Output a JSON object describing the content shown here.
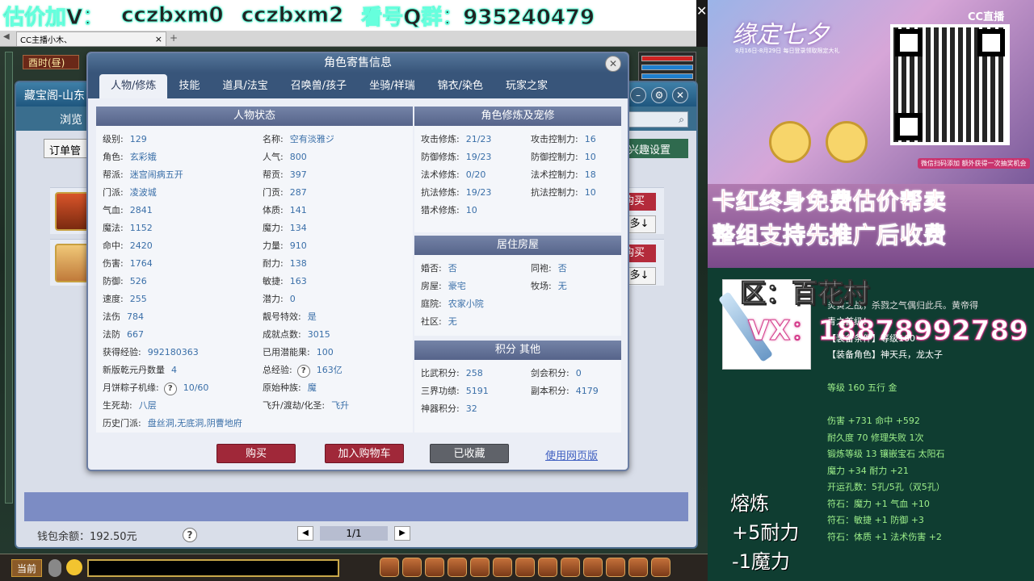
{
  "banner": {
    "part1": "估价加V：",
    "part2": "cczbxm0",
    "part3": "cczbxm2",
    "part4": "看号Q群：935240479"
  },
  "browser": {
    "tab_label": "CC主播小木、",
    "tab_close": "×",
    "tab_add": "+"
  },
  "game": {
    "clock": "酉时(昼)",
    "back_window": {
      "title": "藏宝阁-山东",
      "nav": "浏览",
      "order": "订单管",
      "interest": "兴趣设置",
      "buy": "购买",
      "more": "更多↓",
      "wallet": "钱包余额：192.50元",
      "page": "1/1"
    },
    "taskbar_current": "当前"
  },
  "dialog": {
    "title": "角色寄售信息",
    "close": "✕",
    "tabs": [
      "人物/修炼",
      "技能",
      "道具/法宝",
      "召唤兽/孩子",
      "坐骑/祥瑞",
      "锦衣/染色",
      "玩家之家"
    ],
    "status": {
      "header": "人物状态",
      "left": [
        {
          "k": "级别:",
          "v": "129"
        },
        {
          "k": "角色:",
          "v": "玄彩娥"
        },
        {
          "k": "帮派:",
          "v": "迷宫闹病五开"
        },
        {
          "k": "门派:",
          "v": "凌波城"
        },
        {
          "k": "气血:",
          "v": "2841"
        },
        {
          "k": "魔法:",
          "v": "1152"
        },
        {
          "k": "命中:",
          "v": "2420"
        },
        {
          "k": "伤害:",
          "v": "1764"
        },
        {
          "k": "防御:",
          "v": "526"
        },
        {
          "k": "速度:",
          "v": "255"
        },
        {
          "k": "法伤",
          "v": "784"
        },
        {
          "k": "法防",
          "v": "667"
        },
        {
          "k": "获得经验:",
          "v": "992180363"
        },
        {
          "k": "新版乾元丹数量",
          "v": "4"
        },
        {
          "k": "月饼粽子机缘:",
          "v": "10/60"
        },
        {
          "k": "生死劫:",
          "v": "八层"
        },
        {
          "k": "历史门派:",
          "v": "盘丝洞,无底洞,阴曹地府"
        }
      ],
      "right": [
        {
          "k": "名称:",
          "v": "空有淡雅ジ"
        },
        {
          "k": "人气:",
          "v": "800"
        },
        {
          "k": "帮贡:",
          "v": "397"
        },
        {
          "k": "门贡:",
          "v": "287"
        },
        {
          "k": "体质:",
          "v": "141"
        },
        {
          "k": "魔力:",
          "v": "134"
        },
        {
          "k": "力量:",
          "v": "910"
        },
        {
          "k": "耐力:",
          "v": "138"
        },
        {
          "k": "敏捷:",
          "v": "163"
        },
        {
          "k": "潜力:",
          "v": "0"
        },
        {
          "k": "靓号特效:",
          "v": "是"
        },
        {
          "k": "成就点数:",
          "v": "3015"
        },
        {
          "k": "已用潜能果:",
          "v": "100"
        },
        {
          "k": "总经验:",
          "v": "163亿"
        },
        {
          "k": "原始种族:",
          "v": "魔"
        },
        {
          "k": "飞升/渡劫/化圣:",
          "v": "飞升"
        }
      ]
    },
    "cultivation": {
      "header": "角色修炼及宠修",
      "left": [
        {
          "k": "攻击修炼:",
          "v": "21/23"
        },
        {
          "k": "防御修炼:",
          "v": "19/23"
        },
        {
          "k": "法术修炼:",
          "v": "0/20"
        },
        {
          "k": "抗法修炼:",
          "v": "19/23"
        },
        {
          "k": "猎术修炼:",
          "v": "10"
        }
      ],
      "right": [
        {
          "k": "攻击控制力:",
          "v": "16"
        },
        {
          "k": "防御控制力:",
          "v": "10"
        },
        {
          "k": "法术控制力:",
          "v": "18"
        },
        {
          "k": "抗法控制力:",
          "v": "10"
        }
      ]
    },
    "house": {
      "header": "居住房屋",
      "rows": [
        {
          "k": "婚否:",
          "v": "否",
          "k2": "同袍:",
          "v2": "否"
        },
        {
          "k": "房屋:",
          "v": "豪宅",
          "k2": "牧场:",
          "v2": "无"
        },
        {
          "k": "庭院:",
          "v": "农家小院",
          "k2": "",
          "v2": ""
        },
        {
          "k": "社区:",
          "v": "无",
          "k2": "",
          "v2": ""
        }
      ]
    },
    "score": {
      "header": "积分 其他",
      "rows": [
        {
          "k": "比武积分:",
          "v": "258",
          "k2": "剑会积分:",
          "v2": "0"
        },
        {
          "k": "三界功绩:",
          "v": "5191",
          "k2": "副本积分:",
          "v2": "4179"
        },
        {
          "k": "神器积分:",
          "v": "32",
          "k2": "",
          "v2": ""
        }
      ]
    },
    "buttons": {
      "buy": "购买",
      "cart": "加入购物车",
      "saved": "已收藏",
      "web": "使用网页版"
    }
  },
  "stream": {
    "poster_title": "缘定七夕",
    "poster_sub": "8月16日-8月29日 每日登录领取限定大礼",
    "cc_logo": "CC直播",
    "poster_note": "微信扫码添加 额外获得一次抽奖机会",
    "promo1": "卡红终身免费估价帮卖",
    "promo2": "整组支持先推广后收费",
    "area": "区：百花村",
    "vx": "VX：18878992789",
    "desc_lines": [
      "炎黄之战，杀戮之气偶归此兵。黄帝得",
      "青之首级！",
      "【装备条件】等级160",
      "【装备角色】神天兵，龙太子",
      "",
      "等级 160  五行 金",
      "",
      "伤害 +731 命中 +592",
      "耐久度 70 修理失败 1次",
      "锻炼等级 13 镶嵌宝石 太阳石",
      "魔力 +34 耐力 +21",
      "开运孔数：5孔/5孔（双5孔）",
      "符石：魔力 +1 气血 +10",
      "符石：敏捷 +1 防御 +3",
      "符石：体质 +1 法术伤害 +2"
    ],
    "refine": "熔炼",
    "refine1": "+5耐力",
    "refine2": "-1魔力"
  },
  "colors": {
    "accent_red": "#a02839",
    "link_blue": "#3f5fc0",
    "value_blue": "#3a6fa8",
    "panel_header": "#56648a"
  }
}
